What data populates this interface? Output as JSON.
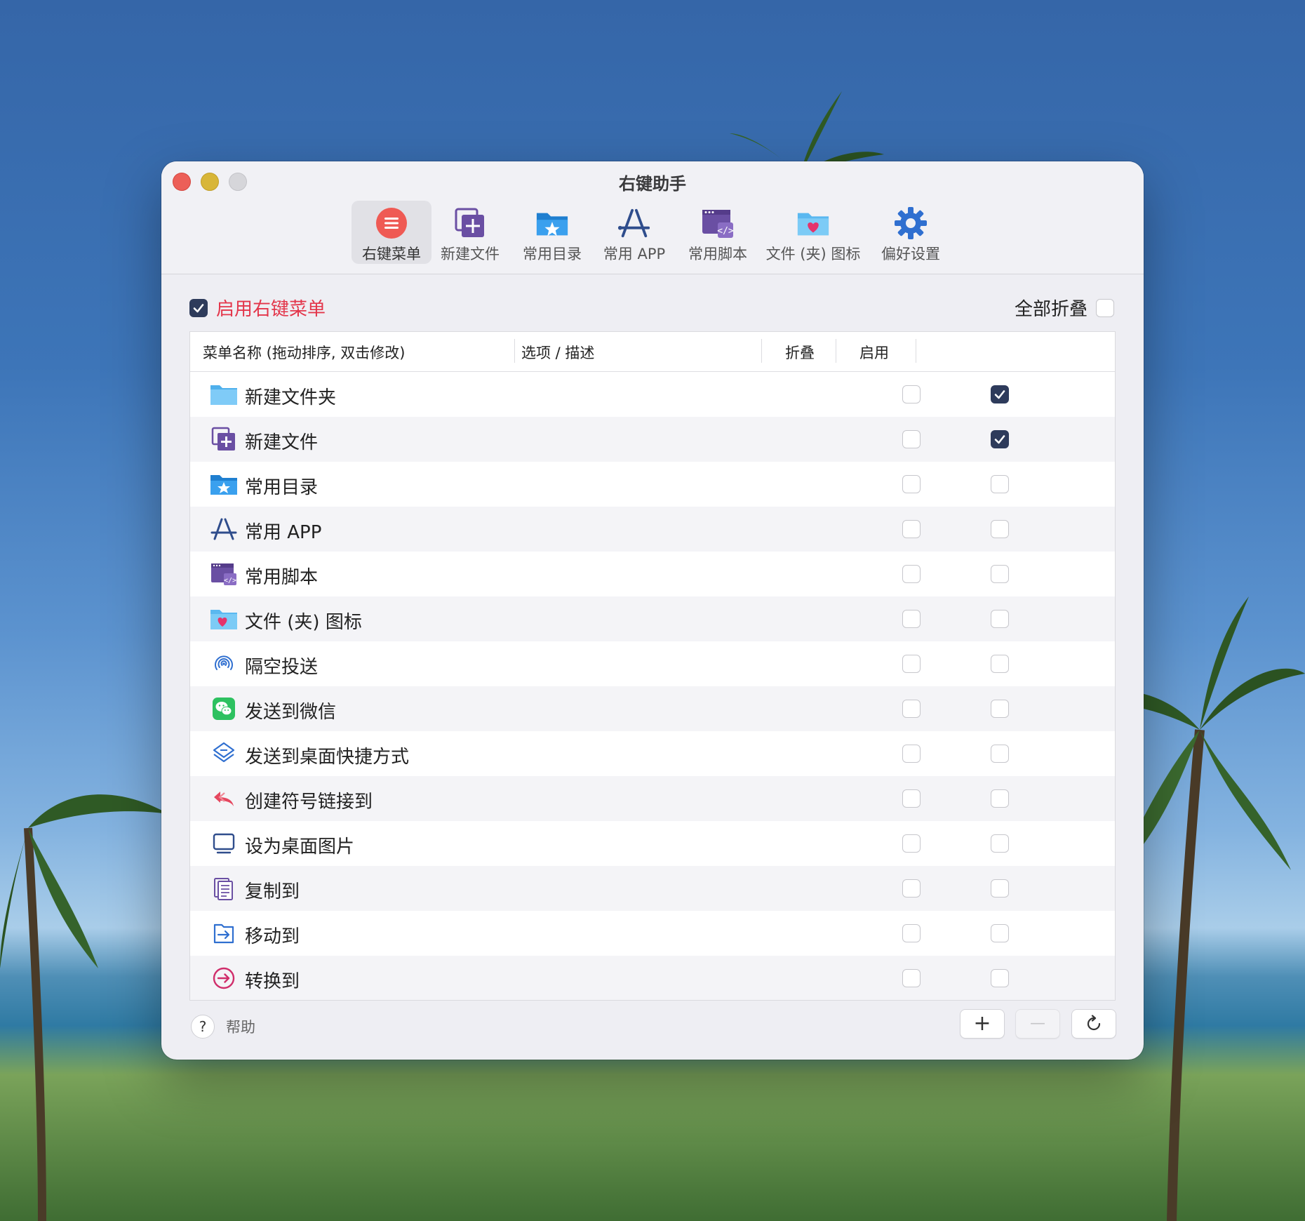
{
  "window": {
    "title": "右键助手"
  },
  "toolbar": {
    "items": [
      {
        "label": "右键菜单",
        "icon": "context-menu-icon",
        "active": true
      },
      {
        "label": "新建文件",
        "icon": "new-file-icon",
        "active": false
      },
      {
        "label": "常用目录",
        "icon": "favorite-folder-icon",
        "active": false
      },
      {
        "label": "常用 APP",
        "icon": "app-store-icon",
        "active": false
      },
      {
        "label": "常用脚本",
        "icon": "script-icon",
        "active": false
      },
      {
        "label": "文件 (夹) 图标",
        "icon": "folder-heart-icon",
        "active": false
      },
      {
        "label": "偏好设置",
        "icon": "gear-icon",
        "active": false
      }
    ]
  },
  "main": {
    "enable_label": "启用右键菜单",
    "enable_checked": true,
    "collapse_all_label": "全部折叠",
    "collapse_all_checked": false
  },
  "table": {
    "columns": [
      "菜单名称 (拖动排序, 双击修改)",
      "选项 / 描述",
      "折叠",
      "启用"
    ],
    "rows": [
      {
        "name": "新建文件夹",
        "icon": "folder-icon",
        "fold": false,
        "enabled": true
      },
      {
        "name": "新建文件",
        "icon": "new-file-icon",
        "fold": false,
        "enabled": true
      },
      {
        "name": "常用目录",
        "icon": "favorite-folder-icon",
        "fold": false,
        "enabled": false
      },
      {
        "name": "常用 APP",
        "icon": "app-store-icon",
        "fold": false,
        "enabled": false
      },
      {
        "name": "常用脚本",
        "icon": "script-icon",
        "fold": false,
        "enabled": false
      },
      {
        "name": "文件 (夹) 图标",
        "icon": "folder-heart-icon",
        "fold": false,
        "enabled": false
      },
      {
        "name": "隔空投送",
        "icon": "airdrop-icon",
        "fold": false,
        "enabled": false
      },
      {
        "name": "发送到微信",
        "icon": "wechat-icon",
        "fold": false,
        "enabled": false
      },
      {
        "name": "发送到桌面快捷方式",
        "icon": "shortcut-icon",
        "fold": false,
        "enabled": false
      },
      {
        "name": "创建符号链接到",
        "icon": "symlink-icon",
        "fold": false,
        "enabled": false
      },
      {
        "name": "设为桌面图片",
        "icon": "monitor-icon",
        "fold": false,
        "enabled": false
      },
      {
        "name": "复制到",
        "icon": "copy-icon",
        "fold": false,
        "enabled": false
      },
      {
        "name": "移动到",
        "icon": "move-icon",
        "fold": false,
        "enabled": false
      },
      {
        "name": "转换到",
        "icon": "convert-icon",
        "fold": false,
        "enabled": false
      }
    ]
  },
  "footer": {
    "help_glyph": "?",
    "help_label": "帮助",
    "add_glyph": "+",
    "remove_glyph": "—",
    "refresh_icon": "refresh-icon"
  },
  "colors": {
    "accent_red": "#e3354a",
    "checkbox_checked": "#2e3b5b",
    "folder_blue": "#5ab8f0",
    "purple": "#6a4fa3",
    "navy": "#2f4d8c"
  }
}
